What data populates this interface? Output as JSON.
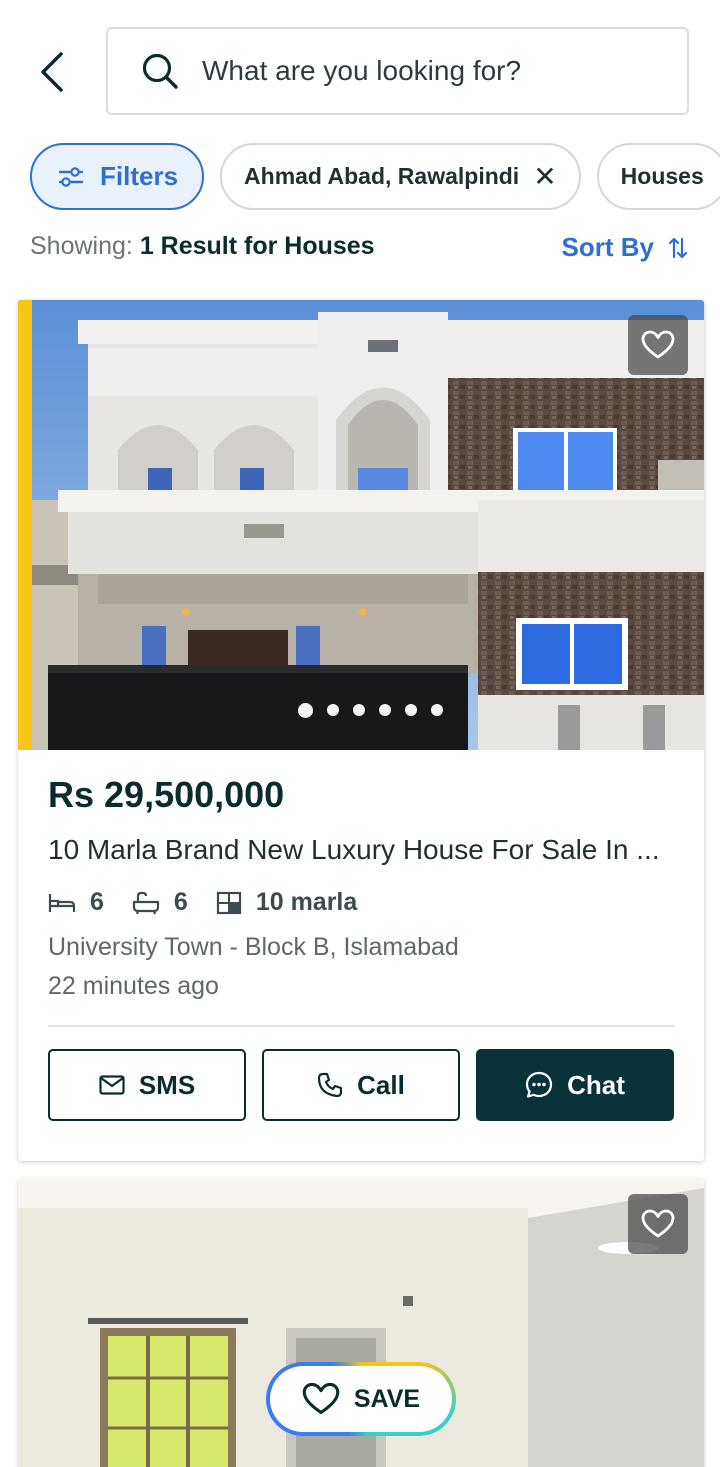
{
  "search": {
    "placeholder": "What are you looking for?"
  },
  "chips": {
    "filters_label": "Filters",
    "location_label": "Ahmad Abad, Rawalpindi",
    "location_clear": "✕",
    "type_label": "Houses"
  },
  "results": {
    "prefix": "Showing:",
    "summary": "1 Result for Houses",
    "sort_label": "Sort By"
  },
  "listing": {
    "price": "Rs 29,500,000",
    "title": "10 Marla Brand New Luxury House For Sale In ...",
    "beds": "6",
    "baths": "6",
    "area": "10 marla",
    "location": "University Town - Block B, Islamabad",
    "posted": "22 minutes ago",
    "image_count": 6,
    "active_image": 1,
    "actions": {
      "sms": "SMS",
      "call": "Call",
      "chat": "Chat"
    }
  },
  "save_fab": {
    "label": "SAVE"
  },
  "colors": {
    "brand_dark": "#073338",
    "accent_blue": "#2f6fd1",
    "highlight_yellow": "#f5c518"
  }
}
